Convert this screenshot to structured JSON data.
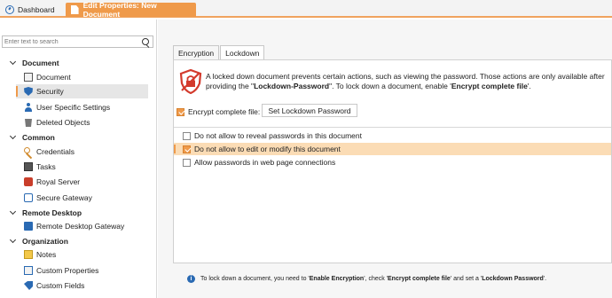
{
  "tabs": {
    "dashboard": "Dashboard",
    "edit": "Edit Properties: New Document"
  },
  "sidebar": {
    "search_placeholder": "Enter text to search",
    "groups": {
      "document": "Document",
      "common": "Common",
      "remote": "Remote Desktop",
      "organization": "Organization"
    },
    "items": {
      "document": "Document",
      "security": "Security",
      "user_specific": "User Specific Settings",
      "deleted": "Deleted Objects",
      "credentials": "Credentials",
      "tasks": "Tasks",
      "royal": "Royal Server",
      "gateway": "Secure Gateway",
      "rdg": "Remote Desktop Gateway",
      "notes": "Notes",
      "custom_props": "Custom Properties",
      "custom_fields": "Custom Fields"
    }
  },
  "main": {
    "subtabs": [
      "Encryption",
      "Lockdown"
    ],
    "info": {
      "line1": "A locked down document prevents certain actions, such as viewing the password. Those actions are only available after providing the \"",
      "bold1": "Lockdown-Password",
      "mid": "\". To lock down a document, enable '",
      "bold2": "Encrypt complete file",
      "end": "'."
    },
    "encrypt_label": "Encrypt complete file:",
    "set_lockdown_button": "Set Lockdown Password",
    "options": [
      "Do not allow to reveal passwords in this document",
      "Do not allow to edit or modify this document",
      "Allow passwords in web page connections"
    ],
    "footer": {
      "t1": "To lock down a document, you need to '",
      "b1": "Enable Encryption",
      "t2": "', check '",
      "b2": "Encrypt complete file",
      "t3": "' and set a '",
      "b3": "Lockdown Password",
      "t4": "'."
    }
  },
  "colors": {
    "accent": "#ef9a4a",
    "highlight": "#fbdcb5",
    "lock_red": "#d33a2c",
    "blue": "#2a6ab3"
  }
}
